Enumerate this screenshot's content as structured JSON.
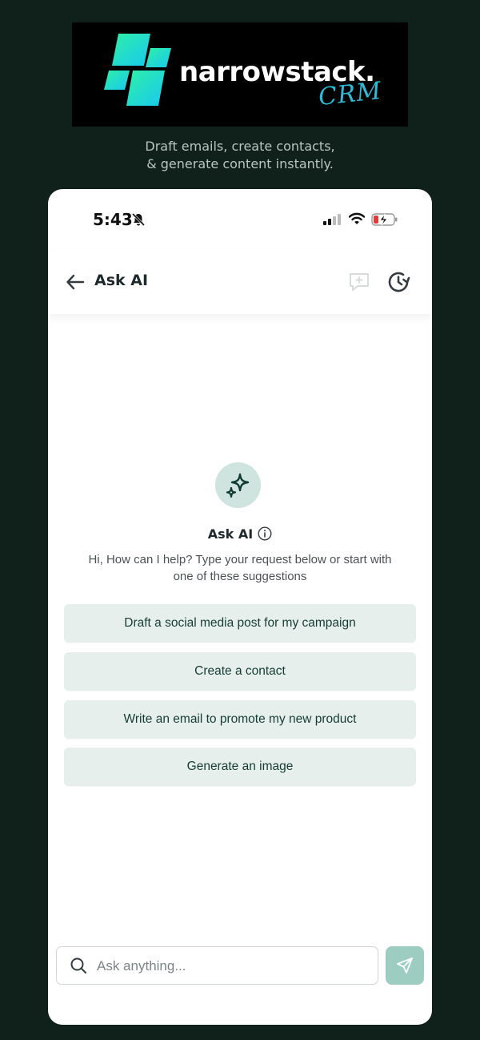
{
  "brand": {
    "name": "narrowstack.",
    "suffix": "CRM",
    "tagline_line1": "Draft emails, create contacts,",
    "tagline_line2": "& generate content instantly.",
    "logo_gradient": [
      "#2ef0a6",
      "#19c8f0"
    ]
  },
  "status_bar": {
    "time": "5:43",
    "icons": [
      "bell-muted-icon",
      "signal-icon",
      "wifi-icon",
      "battery-charging-icon"
    ]
  },
  "header": {
    "title": "Ask AI",
    "icons": [
      "back-arrow-icon",
      "new-chat-icon",
      "history-icon"
    ]
  },
  "hero": {
    "icon": "sparkles-icon",
    "title": "Ask AI",
    "info_icon": "info-icon",
    "subtitle_line1": "Hi, How can I help? Type your request below or start with",
    "subtitle_line2": "one of these suggestions"
  },
  "suggestions": [
    "Draft a social media post for my campaign",
    "Create a contact",
    "Write an email to promote my new product",
    "Generate an image"
  ],
  "composer": {
    "placeholder": "Ask anything...",
    "value": "",
    "icons": [
      "search-icon",
      "send-icon"
    ]
  },
  "colors": {
    "page_background": "#10201b",
    "accent": "#9ccdc0",
    "suggestion_bg": "#e6efec",
    "suggestion_text": "#163c33"
  }
}
